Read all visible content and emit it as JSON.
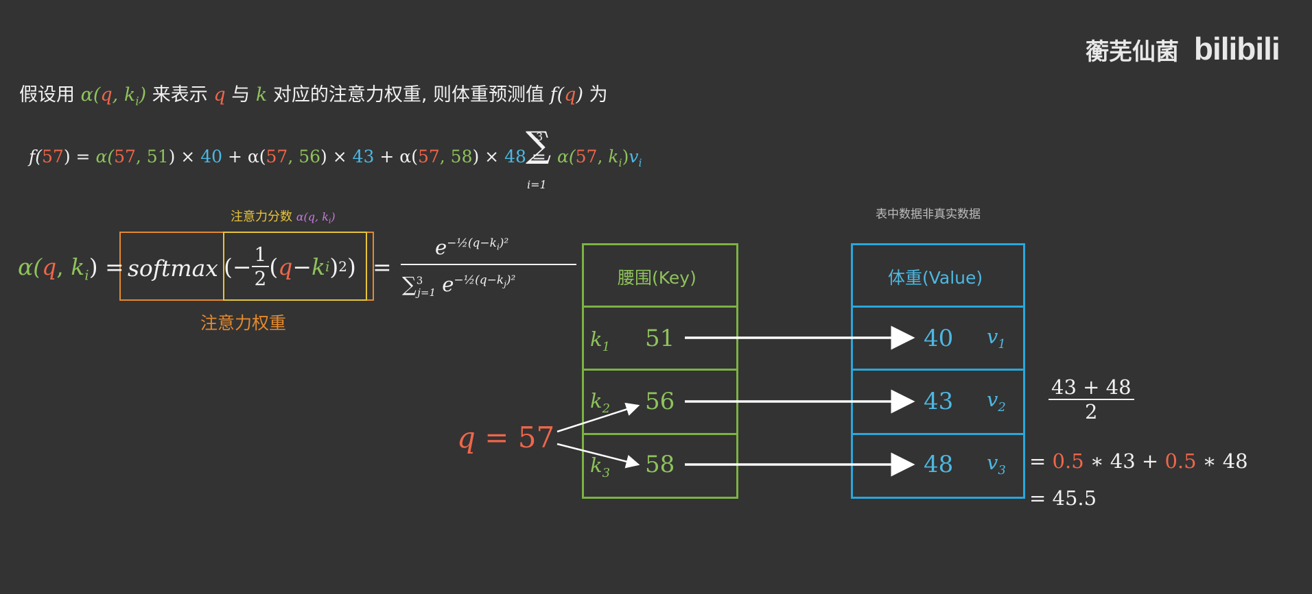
{
  "watermark": {
    "channel": "蘅芜仙菌",
    "brand": "bilibili"
  },
  "intro": {
    "p1": "假设用",
    "alpha": "α(",
    "q": "q",
    "comma": ", ",
    "k": "k",
    "sub_i": "i",
    "close": ")",
    "p2": "来表示",
    "p3": "与",
    "p4": "对应的注意力权重, 则体重预测值",
    "f_open": "f(",
    "p5": "为"
  },
  "sum_formula": {
    "f57": "f(",
    "n57": "57",
    "eq": ") = ",
    "t1a": "α(",
    "t1b": ", ",
    "t1k": "51",
    "t1c": ") × ",
    "t1v": "40",
    "t2a": " + α(",
    "t2k": "56",
    "t2v": "43",
    "t3k": "58",
    "t3v": "48",
    "sum_eq": " = ",
    "sigma": "∑",
    "upper": "3",
    "lower": "i=1",
    "tail_a": "α(",
    "tail_k": "k",
    "tail_i": "i",
    "tail_c": ")",
    "tail_v": "v",
    "tail_vi": "i"
  },
  "score_label": {
    "text": "注意力分数",
    "expr": "α(q, k",
    "expr_i": "i",
    "expr_c": ")"
  },
  "weight_label": "注意力权重",
  "softmax_eq": {
    "lhs_a": "α(",
    "lhs_q": "q",
    "lhs_comma": ", ",
    "lhs_k": "k",
    "lhs_i": "i",
    "lhs_c": ") =",
    "softmax": "softmax",
    "open": "(−",
    "half_num": "1",
    "half_den": "2",
    "inner_a": "(",
    "inner_q": "q",
    "inner_minus": " − ",
    "inner_k": "k",
    "inner_i": "i",
    "inner_c": ")",
    "sq": "2",
    "close": ")",
    "eq": "=",
    "num_e": "e",
    "num_exp": "−½(q−k",
    "num_exp_i": "i",
    "num_exp_c": ")²",
    "den_sigma": "∑",
    "den_upper": "3",
    "den_lower": "j=1",
    "den_e": " e",
    "den_exp": "−½(q−k",
    "den_exp_j": "j",
    "den_exp_c": ")²"
  },
  "note": "表中数据非真实数据",
  "key_table": {
    "header": "腰围(Key)",
    "rows": [
      {
        "k": "k",
        "sub": "1",
        "value": "51"
      },
      {
        "k": "k",
        "sub": "2",
        "value": "56"
      },
      {
        "k": "k",
        "sub": "3",
        "value": "58"
      }
    ]
  },
  "value_table": {
    "header": "体重(Value)",
    "rows": [
      {
        "value": "40",
        "v": "v",
        "sub": "1"
      },
      {
        "value": "43",
        "v": "v",
        "sub": "2"
      },
      {
        "value": "48",
        "v": "v",
        "sub": "3"
      }
    ]
  },
  "query": {
    "q": "q",
    "eq": " = ",
    "value": "57"
  },
  "calc": {
    "frac_num": "43 + 48",
    "frac_den": "2",
    "line1_eq": "= ",
    "w1": "0.5",
    "line1_mid": " ∗ 43 + ",
    "w2": "0.5",
    "line1_end": " ∗ 48",
    "line2": "= 45.5"
  },
  "colors": {
    "background": "#333333",
    "query": "#f0664a",
    "key": "#8fc35c",
    "value": "#4db8e3",
    "weight": "#e58a2e",
    "score": "#e7c43a",
    "text": "#f2f2f2"
  }
}
